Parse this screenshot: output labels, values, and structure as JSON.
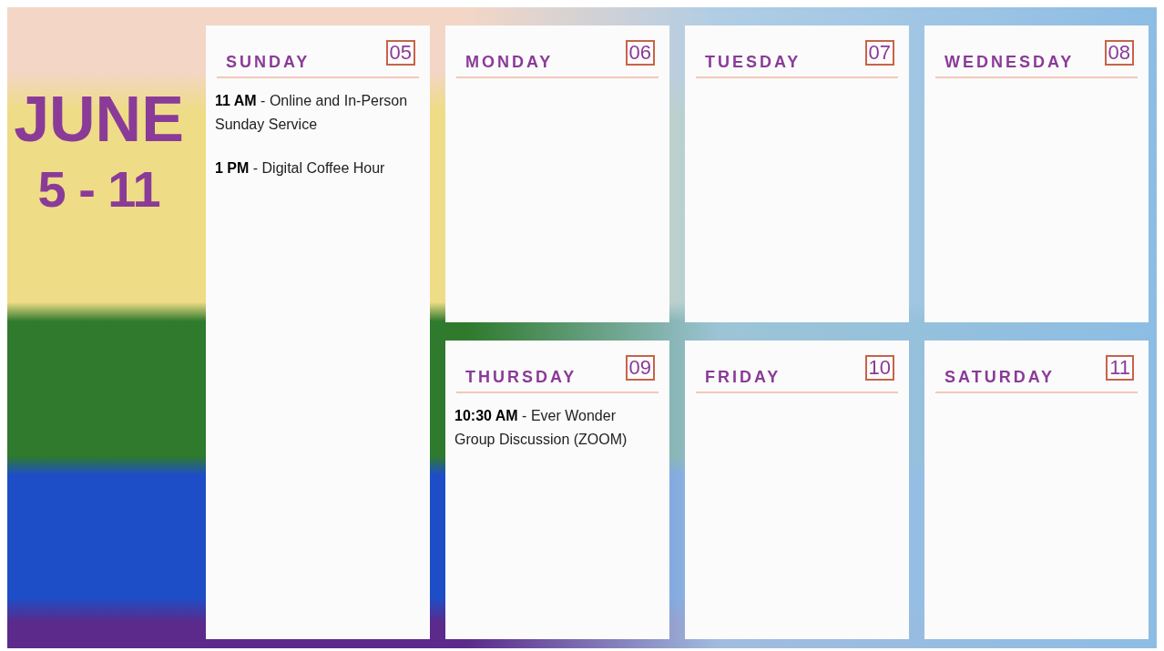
{
  "month": "JUNE",
  "range": "5 - 11",
  "days": [
    {
      "name": "SUNDAY",
      "date": "05",
      "events": [
        "**11 AM** - Online and In-Person Sunday Service",
        "**1 PM** - Digital Coffee Hour"
      ]
    },
    {
      "name": "MONDAY",
      "date": "06"
    },
    {
      "name": "TUESDAY",
      "date": "07"
    },
    {
      "name": "WEDNESDAY",
      "date": "08"
    },
    {
      "name": "THURSDAY",
      "date": "09",
      "events": [
        "**10:30 AM** - Ever Wonder Group Discussion (ZOOM)"
      ]
    },
    {
      "name": "FRIDAY",
      "date": "10"
    },
    {
      "name": "SATURDAY",
      "date": "11"
    }
  ]
}
